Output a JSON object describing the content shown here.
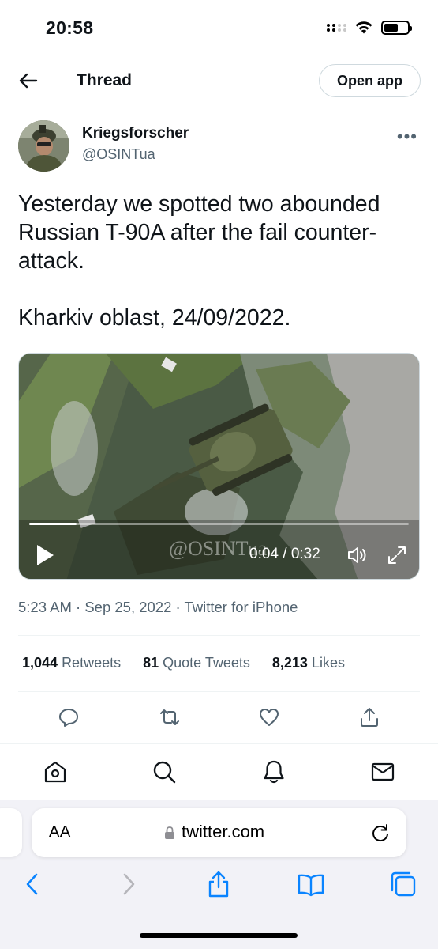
{
  "status_bar": {
    "time": "20:58"
  },
  "header": {
    "title": "Thread",
    "open_app_label": "Open app"
  },
  "author": {
    "name": "Kriegsforscher",
    "handle": "@OSINTua",
    "more": "•••"
  },
  "tweet": {
    "paragraphs": [
      "Yesterday we spotted two abounded Russian T-90A after the fail counter-attack.",
      "Kharkiv oblast, 24/09/2022."
    ]
  },
  "video": {
    "watermark": "@OSINTua",
    "time": "0:04 / 0:32",
    "progress": 0.125
  },
  "meta": {
    "line": "5:23 AM · Sep 25, 2022 · Twitter for iPhone"
  },
  "stats": [
    {
      "count": "1,044",
      "label": "Retweets"
    },
    {
      "count": "81",
      "label": "Quote Tweets"
    },
    {
      "count": "8,213",
      "label": "Likes"
    }
  ],
  "actions": [
    "reply-icon",
    "retweet-icon",
    "like-icon",
    "share-icon"
  ],
  "tabbar": [
    "home-icon",
    "search-icon",
    "notifications-icon",
    "messages-icon"
  ],
  "safari": {
    "aa_label": "AA",
    "url": "twitter.com",
    "toolbar": [
      "back-icon",
      "forward-icon",
      "share-icon",
      "bookmarks-icon",
      "tabs-icon"
    ]
  },
  "colors": {
    "text": "#0f1419",
    "secondary": "#536471",
    "safari_blue": "#0a84ff",
    "border": "#cfd9de"
  }
}
